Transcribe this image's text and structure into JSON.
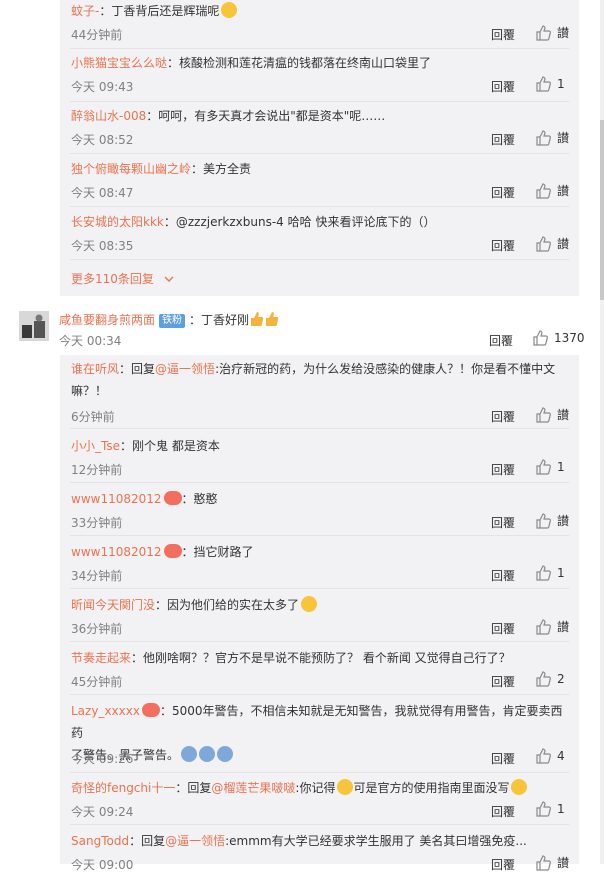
{
  "ui": {
    "reply_label": "回覆",
    "like_text": "讃"
  },
  "box1": {
    "comments": [
      {
        "user": "蚊子-",
        "sep": "：",
        "text": "丁香背后还是辉瑞呢",
        "time": "44分钟前",
        "likes": ""
      },
      {
        "user": "小熊猫宝宝么么哒",
        "sep": "：",
        "text": "核酸检测和莲花清瘟的钱都落在终南山口袋里了",
        "time": "今天 09:43",
        "likes": "1"
      },
      {
        "user": "醉翁山水-008",
        "sep": "：",
        "text": "呵呵，有多天真才会说出\"都是资本\"呢……",
        "time": "今天 08:52",
        "likes": ""
      },
      {
        "user": "独个俯瞰每颗山幽之岭",
        "sep": "：",
        "text": "美方全责",
        "time": "今天 08:47",
        "likes": ""
      },
      {
        "user": "长安城的太阳kkk",
        "sep": "：",
        "text": "@zzzjerkzxbuns-4 哈哈 快来看评论底下的（）",
        "time": "今天 08:35",
        "likes": ""
      }
    ],
    "more_label": "更多110条回复"
  },
  "main_comment": {
    "user": "咸鱼要翻身煎两面",
    "vip": "铁粉",
    "text": "：丁香好刚",
    "time": "今天 00:34",
    "likes": "1370"
  },
  "box2": {
    "comments": [
      {
        "user": "谁在听风",
        "sep": "：",
        "prefix": "回复",
        "mention": "@逼一领悟",
        "text": ":治疗新冠的药，为什么发给没感染的健康人？！你是看不懂中文",
        "text2": "嘛？！",
        "time": "6分钟前",
        "likes": ""
      },
      {
        "user": "小小_Tse",
        "sep": "：",
        "text": "刚个鬼 都是资本",
        "time": "12分钟前",
        "likes": "1"
      },
      {
        "user": "www11082012",
        "sep": "：",
        "text": "憨憨",
        "time": "33分钟前",
        "likes": ""
      },
      {
        "user": "www11082012",
        "sep": "：",
        "text": "挡它财路了",
        "time": "34分钟前",
        "likes": "1"
      },
      {
        "user": "昕闻今天関门没",
        "sep": "：",
        "text": "因为他们给的实在太多了",
        "time": "36分钟前",
        "likes": ""
      },
      {
        "user": "节奏走起来",
        "sep": "：",
        "text": "他刚啥啊？？官方不是早说不能预防了？ 看个新闻 又觉得自己行了？",
        "time": "45分钟前",
        "likes": "2"
      },
      {
        "user": "Lazy_xxxxx",
        "sep": "：",
        "text": "5000年警告，不相信未知就是无知警告，我就觉得有用警告，肯定要卖西药",
        "text2": "了警告。黑子警告。",
        "time": "今天 09:26",
        "likes": "4"
      },
      {
        "user": "奇怪的fengchi十一",
        "sep": "：",
        "prefix": "回复",
        "mention": "@榴莲芒果啵啵",
        "text": ":你记得",
        "text_b": "可是官方的使用指南里面没写",
        "time": "今天 09:24",
        "likes": "1"
      },
      {
        "user": "SangTodd",
        "sep": "：",
        "prefix": "回复",
        "mention": "@逼一领悟",
        "text": ":emmm有大学已经要求学生服用了 美名其曰增强免疫...",
        "time": "今天 09:00",
        "likes": ""
      }
    ]
  },
  "colors": {
    "username": "#eb7350",
    "meta": "#808080",
    "background": "#f2f2f5",
    "vip": "#5e9fe0"
  }
}
